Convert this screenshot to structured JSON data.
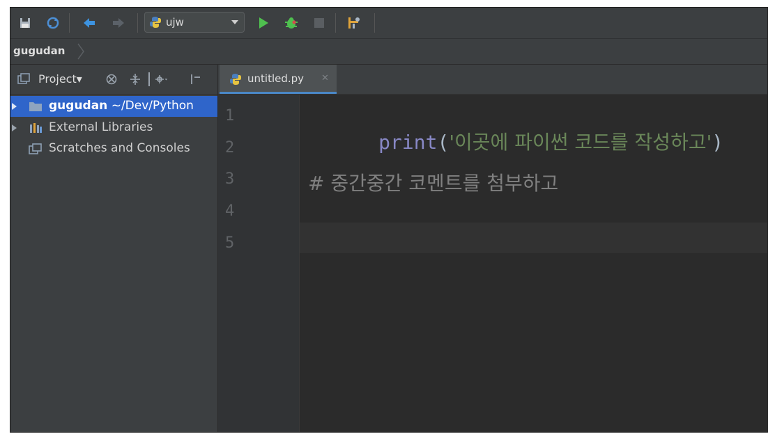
{
  "toolbar": {
    "run_config": "ujw"
  },
  "breadcrumb": {
    "project": "gugudan"
  },
  "project_panel": {
    "title": "Project▾",
    "tree": [
      {
        "name": "gugudan",
        "path": " ~/Dev/Python",
        "selected": true
      },
      {
        "name": "External Libraries"
      },
      {
        "name": "Scratches and Consoles"
      }
    ]
  },
  "editor": {
    "tab_name": "untitled.py",
    "line_numbers": [
      "1",
      "2",
      "3",
      "4",
      "5"
    ],
    "code": {
      "line1_func": "print",
      "line1_open": "(",
      "line1_string": "'이곳에 파이썬 코드를 작성하고'",
      "line1_close": ")",
      "line3_comment": "# 중간중간 코멘트를 첨부하고"
    }
  },
  "colors": {
    "selection": "#2f65ca",
    "editor_bg": "#2b2b2b",
    "panel_bg": "#3c3f41",
    "keyword": "#8888c6",
    "string": "#6a8759",
    "comment": "#808080",
    "run_green": "#4fc04f"
  }
}
